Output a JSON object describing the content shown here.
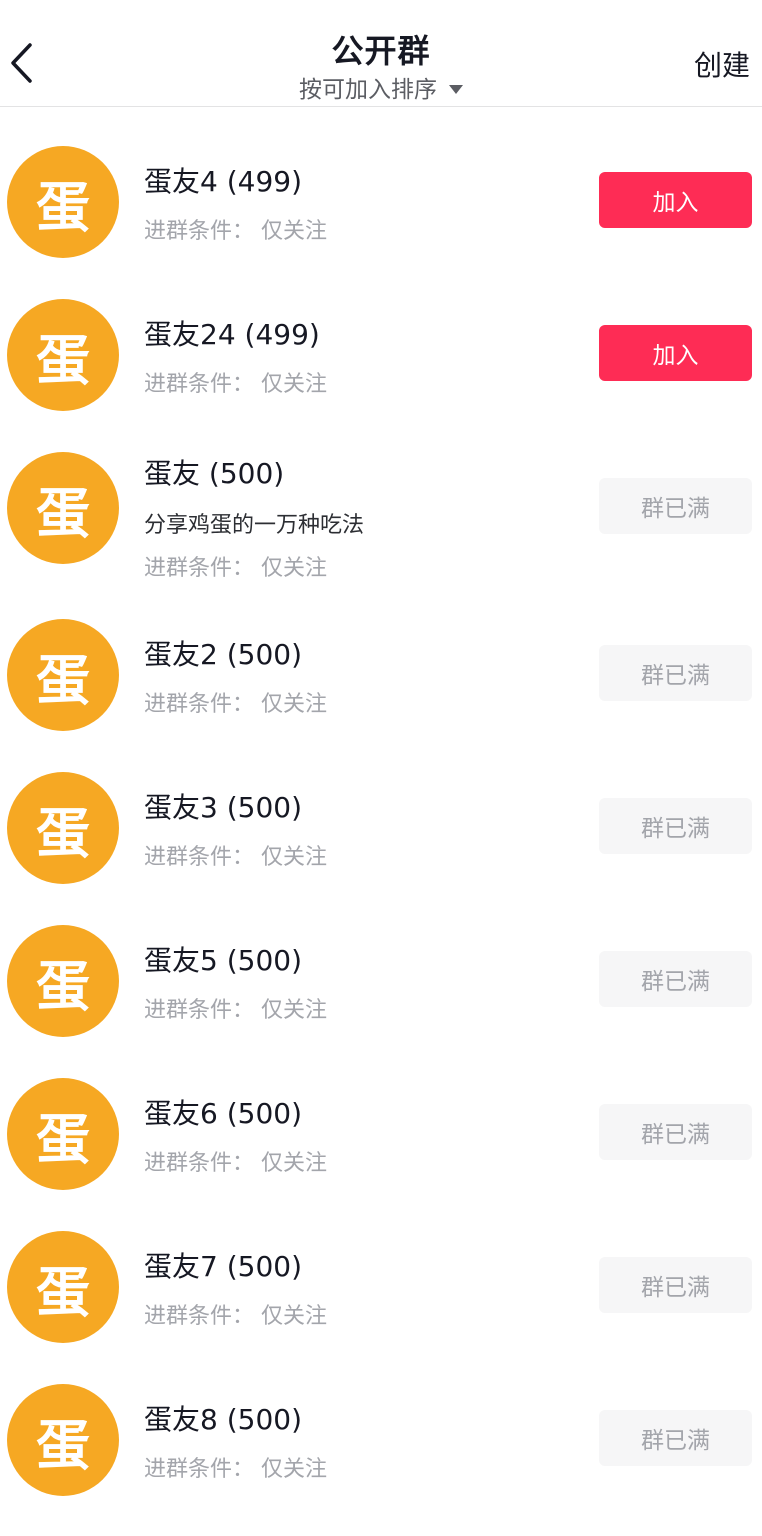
{
  "header": {
    "title": "公开群",
    "sort_label": "按可加入排序",
    "create_label": "创建"
  },
  "condition_prefix": "进群条件：",
  "groups": [
    {
      "avatar": "蛋",
      "name": "蛋友4 (499)",
      "desc": "",
      "condition": "进群条件：  仅关注",
      "button": "加入",
      "state": "join"
    },
    {
      "avatar": "蛋",
      "name": "蛋友24 (499)",
      "desc": "",
      "condition": "进群条件：  仅关注",
      "button": "加入",
      "state": "join"
    },
    {
      "avatar": "蛋",
      "name": "蛋友 (500)",
      "desc": "分享鸡蛋的一万种吃法",
      "condition": "进群条件：  仅关注",
      "button": "群已满",
      "state": "full"
    },
    {
      "avatar": "蛋",
      "name": "蛋友2 (500)",
      "desc": "",
      "condition": "进群条件：  仅关注",
      "button": "群已满",
      "state": "full"
    },
    {
      "avatar": "蛋",
      "name": "蛋友3 (500)",
      "desc": "",
      "condition": "进群条件：  仅关注",
      "button": "群已满",
      "state": "full"
    },
    {
      "avatar": "蛋",
      "name": "蛋友5 (500)",
      "desc": "",
      "condition": "进群条件：  仅关注",
      "button": "群已满",
      "state": "full"
    },
    {
      "avatar": "蛋",
      "name": "蛋友6 (500)",
      "desc": "",
      "condition": "进群条件：  仅关注",
      "button": "群已满",
      "state": "full"
    },
    {
      "avatar": "蛋",
      "name": "蛋友7 (500)",
      "desc": "",
      "condition": "进群条件：  仅关注",
      "button": "群已满",
      "state": "full"
    },
    {
      "avatar": "蛋",
      "name": "蛋友8 (500)",
      "desc": "",
      "condition": "进群条件：  仅关注",
      "button": "群已满",
      "state": "full"
    }
  ],
  "colors": {
    "avatar_bg": "#f6a823",
    "join_button": "#fe2c55",
    "full_button_bg": "#f6f6f7",
    "secondary_text": "#a3a5ab"
  },
  "icons": {
    "back": "chevron-left-icon",
    "sort_caret": "caret-down-icon"
  }
}
